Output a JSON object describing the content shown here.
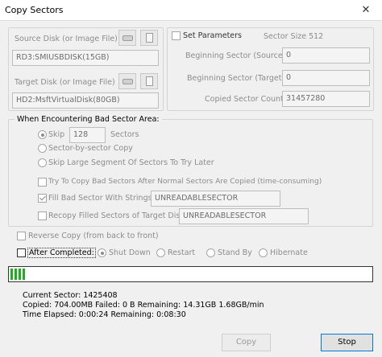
{
  "window": {
    "title": "Copy Sectors",
    "close_glyph": "✕"
  },
  "source": {
    "label": "Source Disk (or Image File)",
    "value": "RD3:SMIUSBDISK(15GB)"
  },
  "target": {
    "label": "Target Disk (or Image File)",
    "value": "HD2:MsftVirtualDisk(80GB)"
  },
  "params": {
    "set_label": "Set Parameters",
    "sector_size": "Sector Size 512",
    "begin_source_label": "Beginning Sector (Source):",
    "begin_source_value": "0",
    "begin_target_label": "Beginning Sector (Target):",
    "begin_target_value": "0",
    "copied_count_label": "Copied Sector Count:",
    "copied_count_value": "31457280"
  },
  "bad_sector": {
    "group_label": "When Encountering Bad Sector Area:",
    "skip_label": "Skip",
    "skip_value": "128",
    "skip_unit": "Sectors",
    "sector_by_sector_label": "Sector-by-sector Copy",
    "skip_large_label": "Skip Large Segment Of Sectors To Try Later",
    "try_copy_label": "Try To Copy Bad Sectors After Normal Sectors Are Copied (time-consuming)",
    "fill_bad_label": "Fill Bad Sector With Strings:",
    "fill_bad_value": "UNREADABLESECTOR",
    "recopy_label": "Recopy Filled Sectors of Target Disk:",
    "recopy_value": "UNREADABLESECTOR"
  },
  "reverse_copy_label": "Reverse Copy (from back to front)",
  "after_completed": {
    "label": "After Completed:",
    "options": [
      "Shut Down",
      "Restart",
      "Stand By",
      "Hibernate"
    ]
  },
  "progress": {
    "fraction": 0.0454,
    "color": "#19b319"
  },
  "status": {
    "current_sector": "Current Sector:  1425408",
    "copied_line": "Copied: 704.00MB  Failed: 0 B  Remaining: 14.31GB  1.68GB/min",
    "time_line": "Time Elapsed:   0:00:24  Remaining:   0:08:30"
  },
  "buttons": {
    "copy": "Copy",
    "stop": "Stop"
  },
  "icons": {
    "source_disk": "disk-icon",
    "source_file": "file-icon",
    "target_disk": "disk-icon",
    "target_file": "file-icon"
  }
}
